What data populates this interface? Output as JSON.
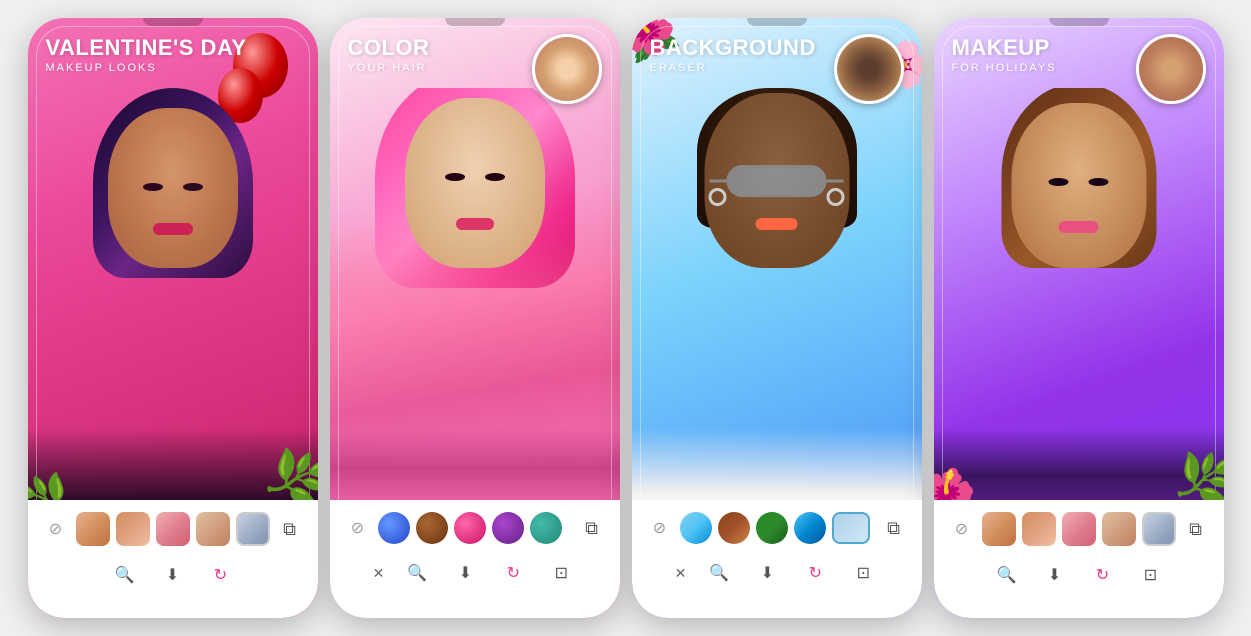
{
  "cards": [
    {
      "id": "card1",
      "title": "VALENTINE'S DAY",
      "subtitle": "MAKEUP LOOKS",
      "bg_color": "#f472b6",
      "swatches": [
        "face1",
        "face2",
        "face3",
        "face4",
        "face5"
      ],
      "actions": [
        "magnify",
        "download",
        "sync"
      ],
      "has_thumbnail": false
    },
    {
      "id": "card2",
      "title": "COLOR",
      "subtitle": "YOUR HAIR",
      "bg_color": "#ec4899",
      "color_swatches": [
        "blue",
        "brown",
        "pink",
        "purple",
        "teal"
      ],
      "actions": [
        "cross",
        "magnify",
        "download",
        "sync",
        "share"
      ],
      "has_thumbnail": true
    },
    {
      "id": "card3",
      "title": "BACKGROUND",
      "subtitle": "ERASER",
      "bg_color": "#3b82f6",
      "color_swatches": [
        "sky",
        "forest",
        "nature",
        "water",
        "selected"
      ],
      "actions": [
        "cross",
        "magnify",
        "download",
        "sync",
        "share"
      ],
      "has_thumbnail": true
    },
    {
      "id": "card4",
      "title": "MAKEUP",
      "subtitle": "FOR HOLIDAYS",
      "bg_color": "#9333ea",
      "swatches": [
        "face1",
        "face2",
        "face3",
        "face4",
        "face5"
      ],
      "actions": [
        "magnify",
        "download",
        "sync",
        "share"
      ],
      "has_thumbnail": true
    }
  ]
}
